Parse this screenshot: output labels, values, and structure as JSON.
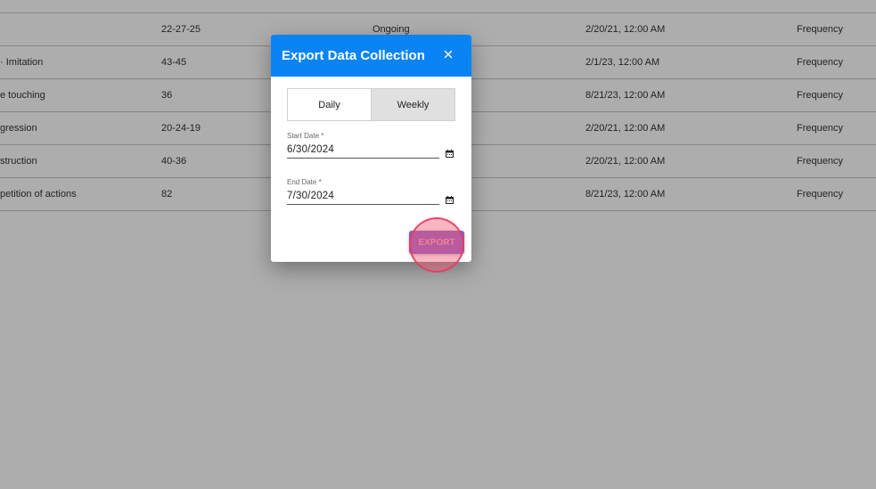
{
  "background_table": {
    "rows": [
      {
        "name": "",
        "code": "22-27-25",
        "status": "Ongoing",
        "date": "2/20/21, 12:00 AM",
        "type": "Frequency"
      },
      {
        "name": "· Imitation",
        "code": "43-45",
        "status": "",
        "date": "2/1/23, 12:00 AM",
        "type": "Frequency"
      },
      {
        "name": "e touching",
        "code": "36",
        "status": "",
        "date": "8/21/23, 12:00 AM",
        "type": "Frequency"
      },
      {
        "name": "gression",
        "code": "20-24-19",
        "status": "",
        "date": "2/20/21, 12:00 AM",
        "type": "Frequency"
      },
      {
        "name": "struction",
        "code": "40-36",
        "status": "",
        "date": "2/20/21, 12:00 AM",
        "type": "Frequency"
      },
      {
        "name": "petition of actions",
        "code": "82",
        "status": "",
        "date": "8/21/23, 12:00 AM",
        "type": "Frequency"
      }
    ]
  },
  "dialog": {
    "title": "Export Data Collection",
    "close_icon": "close-icon",
    "tabs": [
      {
        "label": "Daily",
        "active": true
      },
      {
        "label": "Weekly",
        "active": false
      }
    ],
    "start_date": {
      "label": "Start Date *",
      "value": "6/30/2024",
      "icon": "calendar-icon"
    },
    "end_date": {
      "label": "End Date *",
      "value": "7/30/2024",
      "icon": "calendar-icon"
    },
    "export_label": "EXPORT"
  },
  "colors": {
    "header": "#0a84f5",
    "export_button": "#8a5cc0",
    "click_indicator": "#f05a78"
  }
}
